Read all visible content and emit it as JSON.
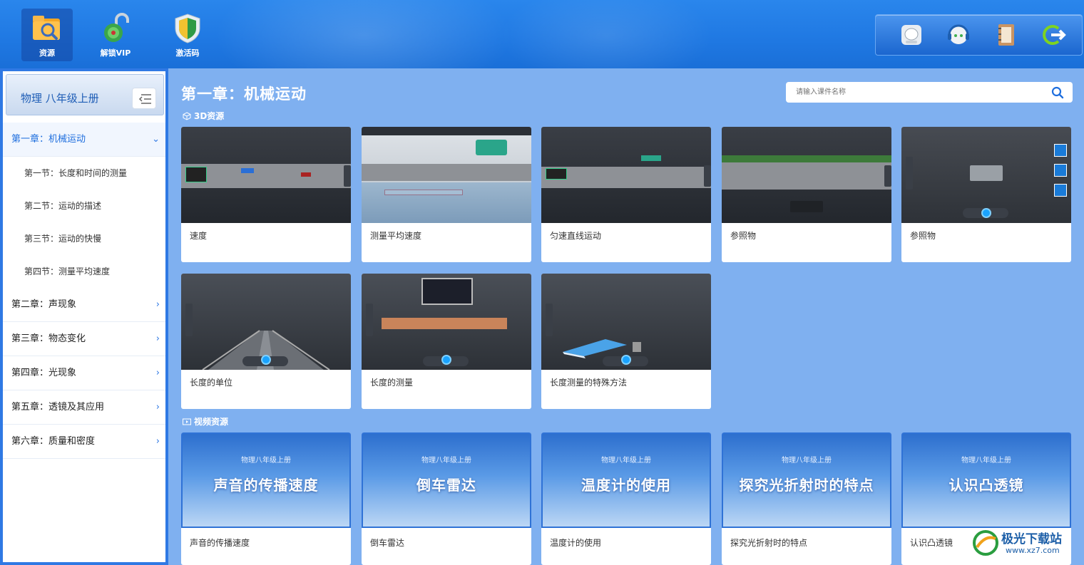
{
  "toolbar": {
    "items": [
      {
        "label": "资源",
        "icon": "folder-search-icon",
        "active": true
      },
      {
        "label": "解锁VIP",
        "icon": "unlock-icon",
        "active": false
      },
      {
        "label": "激活码",
        "icon": "shield-key-icon",
        "active": false
      }
    ],
    "right_icons": [
      "chat-icon",
      "support-icon",
      "notebook-icon",
      "logout-icon"
    ]
  },
  "sidebar": {
    "title": "物理 八年级上册",
    "chapters": [
      {
        "label": "第一章：机械运动",
        "expanded": true
      },
      {
        "label": "第二章：声现象"
      },
      {
        "label": "第三章：物态变化"
      },
      {
        "label": "第四章：光现象"
      },
      {
        "label": "第五章：透镜及其应用"
      },
      {
        "label": "第六章：质量和密度"
      }
    ],
    "sections": [
      {
        "label": "第一节：长度和时间的测量"
      },
      {
        "label": "第二节：运动的描述"
      },
      {
        "label": "第三节：运动的快慢"
      },
      {
        "label": "第四节：测量平均速度"
      }
    ]
  },
  "main": {
    "title": "第一章：机械运动",
    "search_placeholder": "请输入课件名称",
    "section_3d": "3D资源",
    "section_video": "视频资源",
    "cards_3d": [
      {
        "label": "速度"
      },
      {
        "label": "测量平均速度"
      },
      {
        "label": "匀速直线运动"
      },
      {
        "label": "参照物"
      },
      {
        "label": "参照物"
      },
      {
        "label": "长度的单位"
      },
      {
        "label": "长度的测量"
      },
      {
        "label": "长度测量的特殊方法"
      }
    ],
    "cards_video": [
      {
        "label": "声音的传播速度",
        "thumb_title": "声音的传播速度",
        "thumb_sub": "物理八年级上册"
      },
      {
        "label": "倒车雷达",
        "thumb_title": "倒车雷达",
        "thumb_sub": "物理八年级上册"
      },
      {
        "label": "温度计的使用",
        "thumb_title": "温度计的使用",
        "thumb_sub": "物理八年级上册"
      },
      {
        "label": "探究光折射时的特点",
        "thumb_title": "探究光折射时的特点",
        "thumb_sub": "物理八年级上册"
      },
      {
        "label": "认识凸透镜",
        "thumb_title": "认识凸透镜",
        "thumb_sub": "物理八年级上册"
      }
    ]
  },
  "watermark": {
    "text": "极光下载站",
    "url": "www.xz7.com"
  },
  "colors": {
    "accent": "#2f79e4",
    "topbar": "#1f78e2",
    "background": "#7fb0f0"
  }
}
